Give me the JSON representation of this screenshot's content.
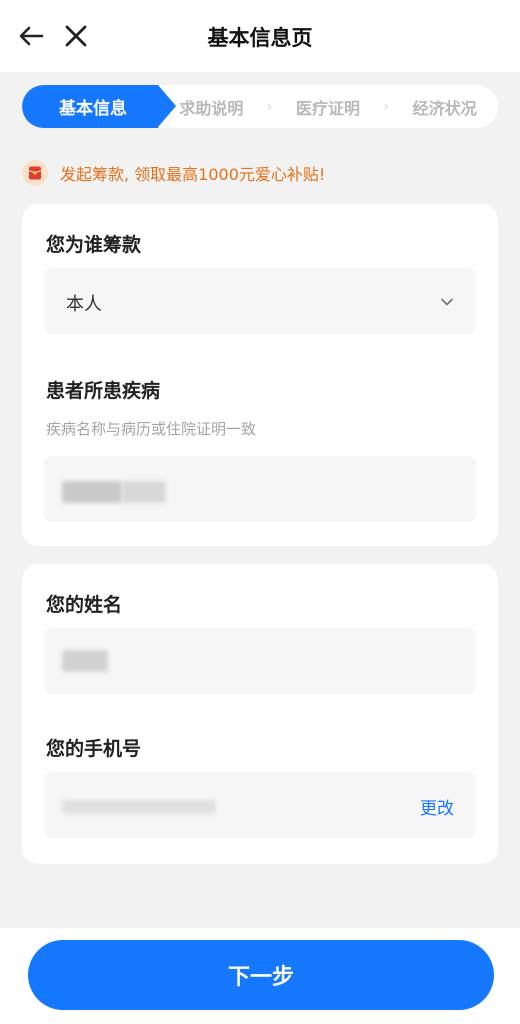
{
  "header": {
    "title": "基本信息页"
  },
  "steps": {
    "active": "基本信息",
    "items": [
      "求助说明",
      "医疗证明",
      "经济状况"
    ]
  },
  "notice": {
    "text": "发起筹款, 领取最高1000元爱心补贴!"
  },
  "card1": {
    "who_label": "您为谁筹款",
    "who_value": "本人",
    "disease_label": "患者所患疾病",
    "disease_hint": "疾病名称与病历或住院证明一致"
  },
  "card2": {
    "name_label": "您的姓名",
    "phone_label": "您的手机号",
    "phone_action": "更改"
  },
  "footer": {
    "next_label": "下一步"
  },
  "colors": {
    "primary": "#1677ff",
    "notice": "#e8701a",
    "background": "#f2f2f2"
  },
  "icons": [
    "back-arrow-icon",
    "close-icon",
    "chevron-down-icon",
    "red-envelope-icon",
    "chevron-right-icon"
  ]
}
